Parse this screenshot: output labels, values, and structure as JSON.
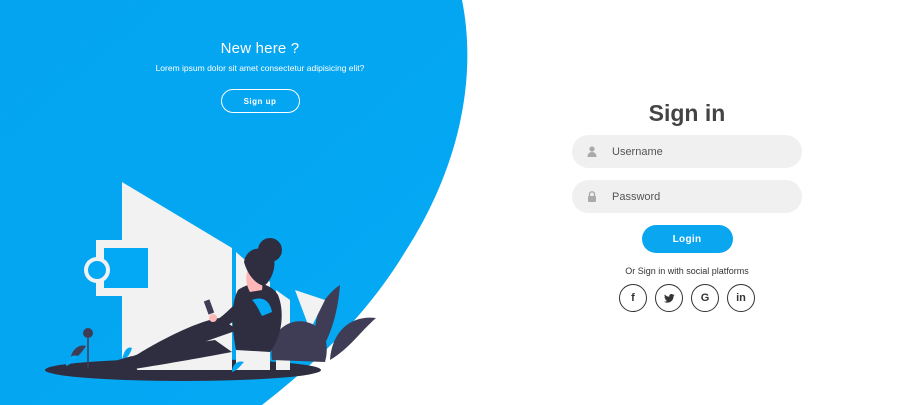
{
  "colors": {
    "accent": "#03a9f4",
    "login_button": "#0aa6f0",
    "field_bg": "#f0f0f0",
    "title": "#444444"
  },
  "left_panel": {
    "title": "New here ?",
    "description": "Lorem ipsum dolor sit amet consectetur adipisicing elit?",
    "signup_label": "Sign up"
  },
  "form": {
    "title": "Sign in",
    "username_placeholder": "Username",
    "password_placeholder": "Password",
    "login_label": "Login",
    "social_text": "Or Sign in with social platforms"
  },
  "socials": [
    {
      "icon": "facebook-icon",
      "glyph": "f"
    },
    {
      "icon": "twitter-icon",
      "glyph": "t"
    },
    {
      "icon": "google-icon",
      "glyph": "G"
    },
    {
      "icon": "linkedin-icon",
      "glyph": "in"
    }
  ]
}
